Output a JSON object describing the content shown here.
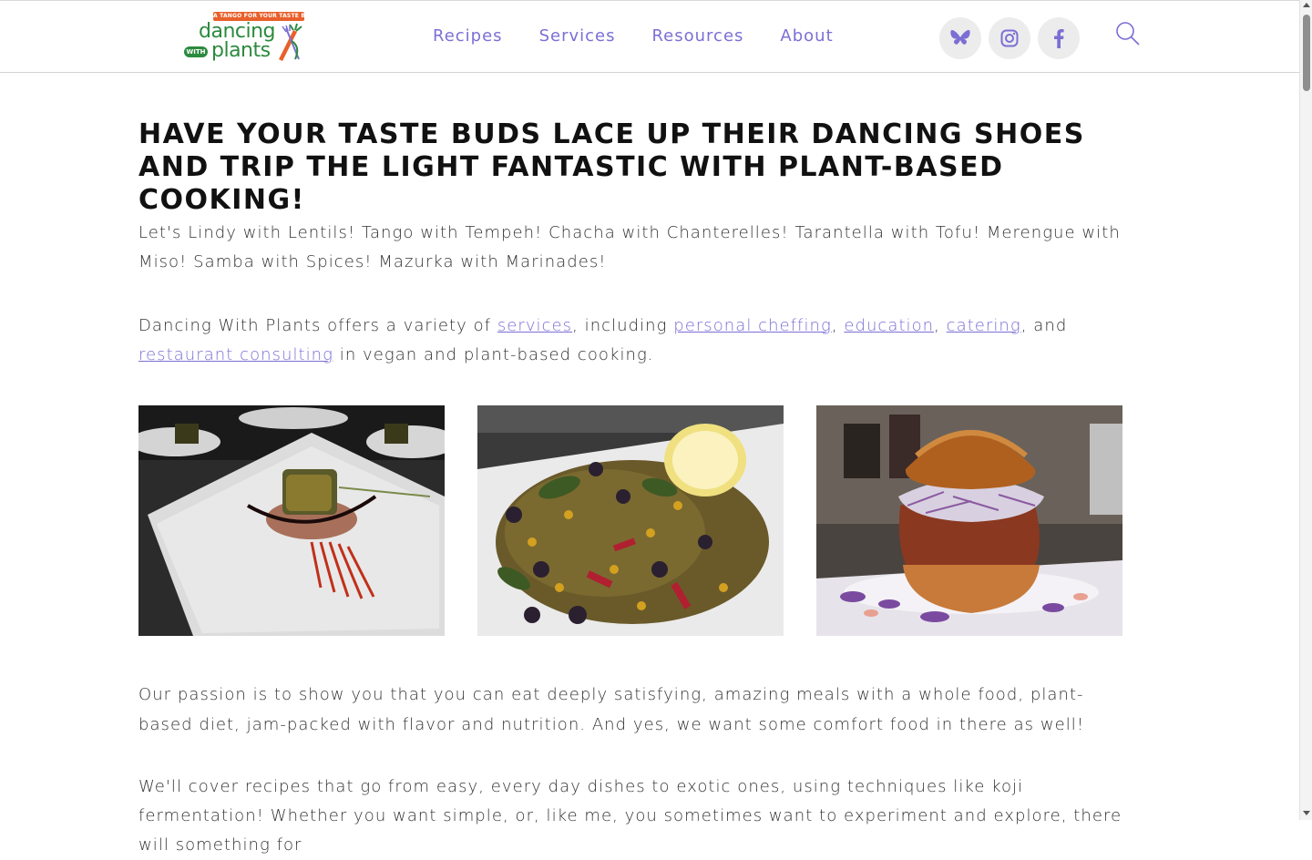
{
  "logo": {
    "banner": "A TANGO FOR YOUR TASTE BUDS",
    "line1": "dancing",
    "with": "WITH",
    "line2": "plants"
  },
  "nav": {
    "items": [
      "Recipes",
      "Services",
      "Resources",
      "About"
    ]
  },
  "social": {
    "icons": [
      "bluesky-icon",
      "instagram-icon",
      "facebook-icon"
    ]
  },
  "colors": {
    "accent": "#7b6fd4",
    "logo_green": "#2c8a3e",
    "logo_orange": "#e8602b"
  },
  "main": {
    "heading": "HAVE YOUR TASTE BUDS LACE UP THEIR DANCING SHOES AND TRIP THE LIGHT FANTASTIC WITH PLANT-BASED COOKING!",
    "intro": "Let's Lindy with Lentils! Tango with Tempeh! Chacha with Chanterelles! Tarantella with Tofu! Merengue with Miso! Samba with Spices! Mazurka with Marinades!",
    "services_p": {
      "before": "Dancing With Plants offers a variety of ",
      "link_services": "services",
      "t1": ", including ",
      "link_chef": "personal cheffing",
      "t2": ", ",
      "link_edu": "education",
      "t3": ", ",
      "link_cater": "catering",
      "t4": ", and ",
      "link_rest": "restaurant consulting",
      "after": " in vegan and plant-based cooking."
    },
    "passion": "Our passion is to show you that you can eat deeply satisfying, amazing meals with a whole food, plant-based diet, jam-packed with flavor and nutrition. And yes, we want some comfort food in there as well!",
    "recipes_p": "We'll cover recipes that go from easy, every day dishes to exotic ones, using techniques like koji fermentation! Whether you want simple, or, like me, you sometimes want to experiment and explore, there will something for"
  }
}
